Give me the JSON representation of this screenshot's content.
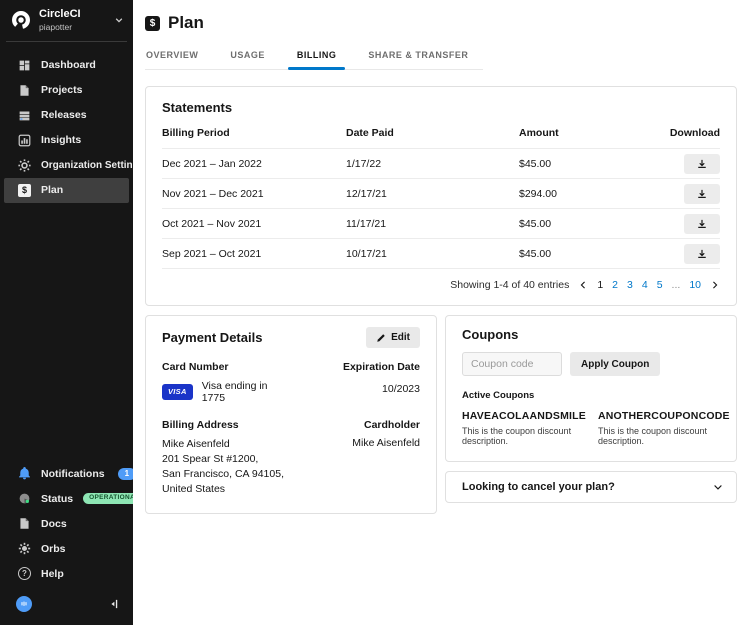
{
  "colors": {
    "accent_blue": "#0078CA",
    "link_blue": "#0078CA",
    "sidebar_bg": "#161616",
    "selected_item_bg": "#3F3F3F",
    "notification_badge_blue": "#4F9CF7",
    "status_green_bg": "#8EE6B4",
    "visa_blue": "#1A34C8"
  },
  "sidebar": {
    "logo_title": "CircleCI",
    "org_name": "piapotter",
    "nav": [
      {
        "label": "Dashboard",
        "icon": "dashboard-icon"
      },
      {
        "label": "Projects",
        "icon": "projects-icon"
      },
      {
        "label": "Releases",
        "icon": "releases-icon"
      },
      {
        "label": "Insights",
        "icon": "insights-icon"
      },
      {
        "label": "Organization Settings",
        "icon": "gear-icon"
      },
      {
        "label": "Plan",
        "icon": "dollar-icon",
        "selected": true
      }
    ],
    "bottom": [
      {
        "label": "Notifications",
        "icon": "bell-icon",
        "badge": "1"
      },
      {
        "label": "Status",
        "icon": "status-icon",
        "badge": "OPERATIONAL"
      },
      {
        "label": "Docs",
        "icon": "docs-icon"
      },
      {
        "label": "Orbs",
        "icon": "orbs-icon"
      },
      {
        "label": "Help",
        "icon": "help-icon"
      }
    ]
  },
  "header": {
    "title": "Plan",
    "icon_glyph": "$"
  },
  "tabs": [
    {
      "label": "OVERVIEW"
    },
    {
      "label": "USAGE"
    },
    {
      "label": "BILLING",
      "active": true
    },
    {
      "label": "SHARE & TRANSFER"
    }
  ],
  "statements": {
    "title": "Statements",
    "columns": [
      "Billing Period",
      "Date Paid",
      "Amount",
      "Download"
    ],
    "rows": [
      {
        "period": "Dec 2021 – Jan 2022",
        "date_paid": "1/17/22",
        "amount": "$45.00"
      },
      {
        "period": "Nov 2021 – Dec 2021",
        "date_paid": "12/17/21",
        "amount": "$294.00"
      },
      {
        "period": "Oct 2021 – Nov 2021",
        "date_paid": "11/17/21",
        "amount": "$45.00"
      },
      {
        "period": "Sep 2021 – Oct 2021",
        "date_paid": "10/17/21",
        "amount": "$45.00"
      }
    ],
    "pagination": {
      "summary": "Showing 1-4 of 40 entries",
      "pages": [
        "1",
        "2",
        "3",
        "4",
        "5",
        "...",
        "10"
      ],
      "current_page": "1"
    }
  },
  "payment": {
    "title": "Payment Details",
    "edit_label": "Edit",
    "card_number_label": "Card Number",
    "visa_badge": "VISA",
    "card_text": "Visa ending in 1775",
    "expiration_label": "Expiration Date",
    "expiration_value": "10/2023",
    "billing_address_label": "Billing Address",
    "address_line1": "Mike Aisenfeld",
    "address_line2": "201 Spear St #1200,",
    "address_line3": "San Francisco, CA 94105, United States",
    "cardholder_label": "Cardholder",
    "cardholder_value": "Mike Aisenfeld"
  },
  "coupons": {
    "title": "Coupons",
    "input_placeholder": "Coupon code",
    "apply_label": "Apply Coupon",
    "active_label": "Active Coupons",
    "items": [
      {
        "code": "HAVEACOLAANDSMILE",
        "description": "This is the coupon discount description."
      },
      {
        "code": "ANOTHERCOUPONCODE",
        "description": "This is the coupon discount description."
      }
    ]
  },
  "cancel": {
    "label": "Looking to cancel your plan?"
  }
}
